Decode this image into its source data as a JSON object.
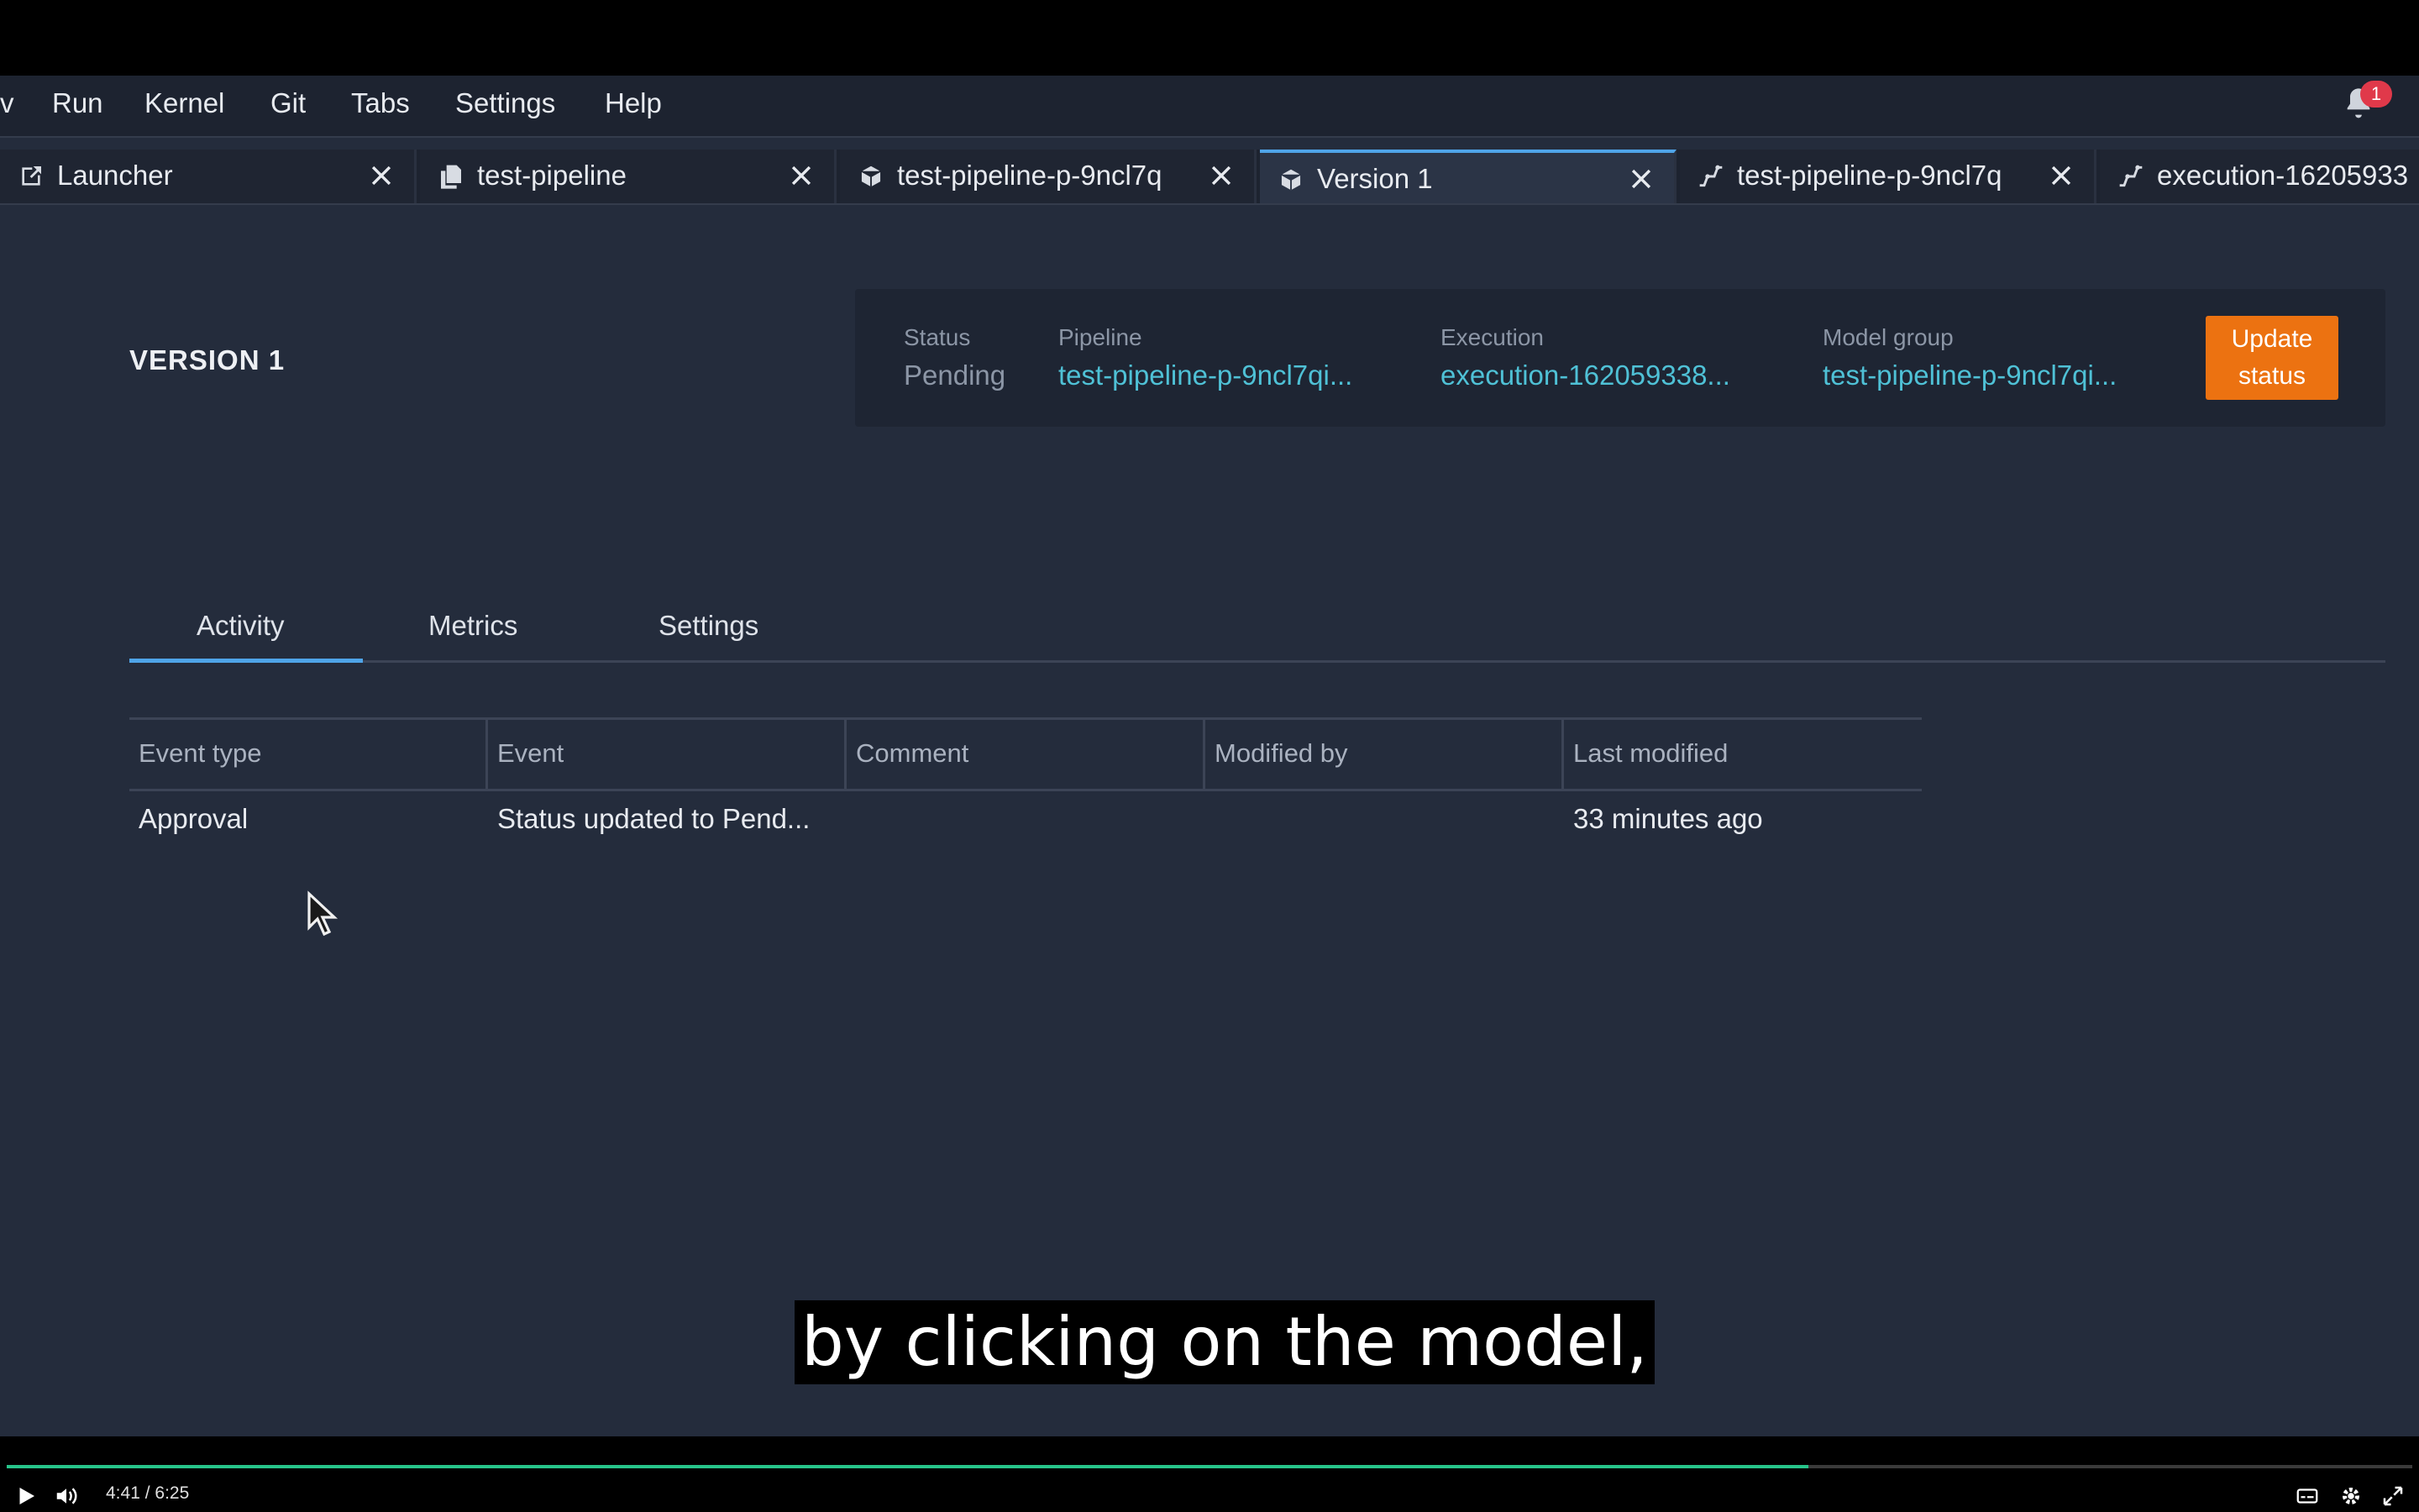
{
  "menu": {
    "items": [
      "v",
      "Run",
      "Kernel",
      "Git",
      "Tabs",
      "Settings",
      "Help"
    ],
    "notification_count": "1"
  },
  "tabs": [
    {
      "label": "Launcher",
      "icon": "launcher-icon",
      "active": false
    },
    {
      "label": "test-pipeline",
      "icon": "pages-icon",
      "active": false
    },
    {
      "label": "test-pipeline-p-9ncl7q",
      "icon": "cube-icon",
      "active": false
    },
    {
      "label": "Version 1",
      "icon": "cube-icon",
      "active": true
    },
    {
      "label": "test-pipeline-p-9ncl7q",
      "icon": "pipeline-icon",
      "active": false
    },
    {
      "label": "execution-16205933",
      "icon": "pipeline-icon",
      "active": false
    }
  ],
  "page": {
    "title": "VERSION 1",
    "status_label": "Status",
    "status_value": "Pending",
    "pipeline_label": "Pipeline",
    "pipeline_value": "test-pipeline-p-9ncl7qi...",
    "execution_label": "Execution",
    "execution_value": "execution-162059338...",
    "model_group_label": "Model group",
    "model_group_value": "test-pipeline-p-9ncl7qi...",
    "update_button": "Update status"
  },
  "subtabs": [
    "Activity",
    "Metrics",
    "Settings"
  ],
  "table": {
    "headers": [
      "Event type",
      "Event",
      "Comment",
      "Modified by",
      "Last modified"
    ],
    "rows": [
      [
        "Approval",
        "Status updated to Pend...",
        "",
        "",
        "33 minutes ago"
      ]
    ]
  },
  "subtitle": "by clicking on the model,",
  "video": {
    "current_time": "4:41",
    "separator": "/",
    "duration": "6:25",
    "progress": 0.749,
    "accent_color": "#27c48a"
  },
  "colors": {
    "accent_blue": "#4fa4e8",
    "link": "#4fc1d6",
    "button_orange": "#ec7211",
    "badge_red": "#e0394a"
  }
}
